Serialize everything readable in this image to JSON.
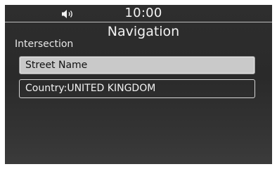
{
  "status_bar": {
    "volume_icon": "speaker-volume-icon",
    "time": "10:00"
  },
  "screen": {
    "title": "Navigation",
    "section_label": "Intersection"
  },
  "menu": {
    "items": [
      {
        "label": "Street Name",
        "selected": true
      },
      {
        "label": "Country:UNITED KINGDOM",
        "selected": false
      }
    ]
  },
  "colors": {
    "background": "#2e2e2e",
    "selected_item": "#c9c9c9",
    "text": "#ffffff"
  }
}
